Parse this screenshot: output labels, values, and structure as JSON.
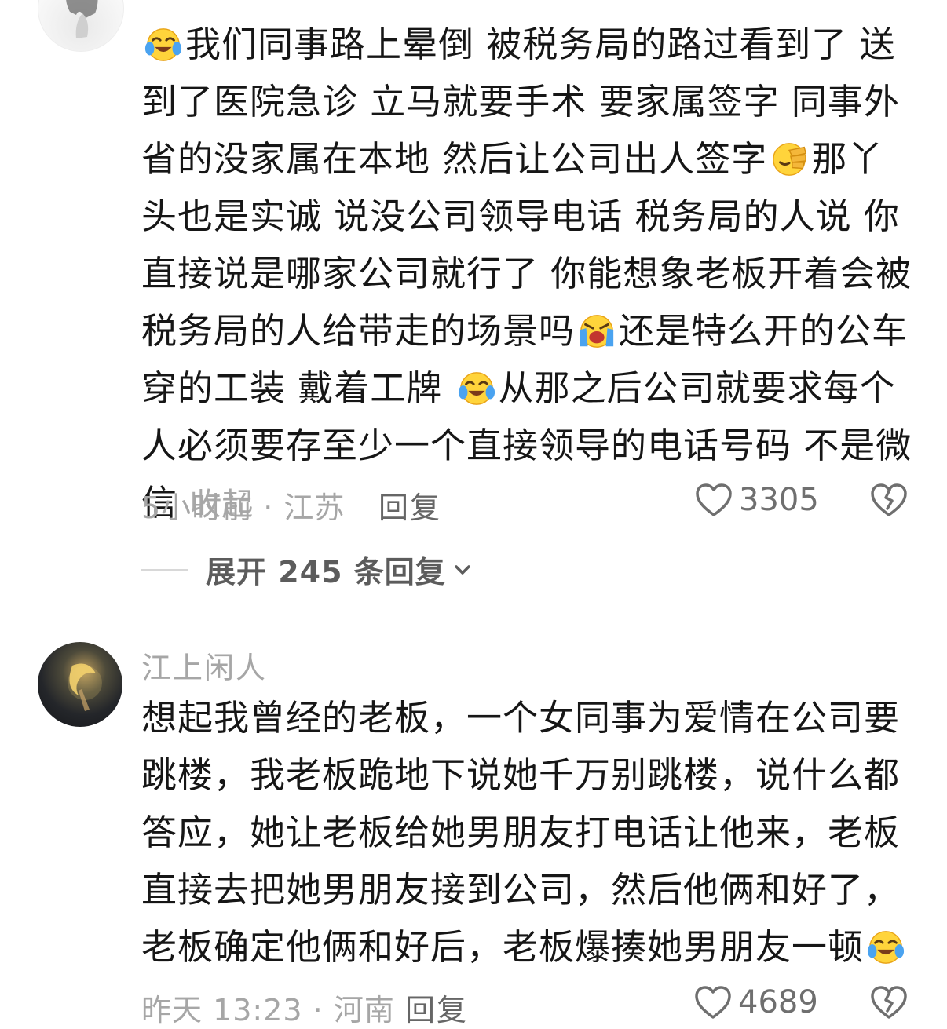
{
  "comments": [
    {
      "segments": [
        "我们同事路上晕倒 被税务局的路过看到了 送到了医院急诊 立马就要手术 要家属签字 同事外省的没家属在本地 然后让公司出人签字",
        "那丫头也是实诚 说没公司领导电话 税务局的人说 你直接说是哪家公司就行了 你能想象老板开着会被税务局的人给带走的场景吗",
        "还是特么开的公车 穿的工装 戴着工牌 ",
        "从那之后公司就要求每个人必须要存至少一个直接领导的电话号码 不是微信 "
      ],
      "emojis": [
        "crying-laugh",
        "facepalm",
        "loud-crying",
        "crying-laugh"
      ],
      "collapse_label": "收起",
      "meta": "5小时前 · 江苏",
      "reply_label": "回复",
      "like_count": "3305",
      "expand_label": "展开 245 条回复"
    },
    {
      "username": "江上闲人",
      "text": "想起我曾经的老板，一个女同事为爱情在公司要跳楼，我老板跪地下说她千万别跳楼，说什么都答应，她让老板给她男朋友打电话让他来，老板直接去把她男朋友接到公司，然后他俩和好了，老板确定他俩和好后，老板爆揍她男朋友一顿",
      "emojis": [
        "crying-laugh"
      ],
      "meta": "昨天 13:23 · 河南",
      "reply_label": "回复",
      "like_count": "4689"
    }
  ],
  "colors": {
    "text": "#161616",
    "meta": "#a6a6a6",
    "emoji_face": "#ffd43b",
    "tears": "#4aa3f0"
  }
}
